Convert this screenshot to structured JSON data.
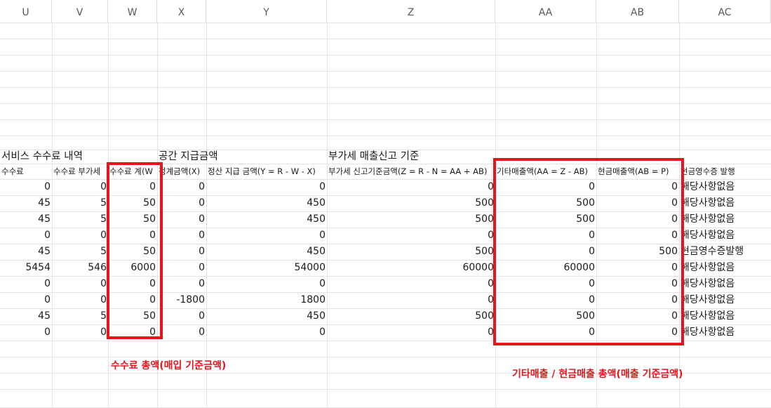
{
  "columns": [
    "U",
    "V",
    "W",
    "X",
    "Y",
    "Z",
    "AA",
    "AB",
    "AC"
  ],
  "sections": {
    "service_fee": "서비스 수수료 내역",
    "space_payment": "공간 지급금액",
    "vat": "부가세 매출신고 기준"
  },
  "headers": [
    "수수료",
    "수수료 부가세",
    "수수료 계(W",
    "정계금액(X)",
    "정산 지급 금액(Y = R - W - X)",
    "부가세 신고기준금액(Z = R - N = AA + AB)",
    "기타매출액(AA = Z - AB)",
    "현금매출액(AB = P)",
    "현금영수증 발행"
  ],
  "rows": [
    [
      "0",
      "0",
      "0",
      "0",
      "0",
      "0",
      "0",
      "0",
      "해당사항없음"
    ],
    [
      "45",
      "5",
      "50",
      "0",
      "450",
      "500",
      "500",
      "0",
      "해당사항없음"
    ],
    [
      "45",
      "5",
      "50",
      "0",
      "450",
      "500",
      "500",
      "0",
      "해당사항없음"
    ],
    [
      "0",
      "0",
      "0",
      "0",
      "0",
      "0",
      "0",
      "0",
      "해당사항없음"
    ],
    [
      "45",
      "5",
      "50",
      "0",
      "450",
      "500",
      "0",
      "500",
      "현금영수증발행"
    ],
    [
      "5454",
      "546",
      "6000",
      "0",
      "54000",
      "60000",
      "60000",
      "0",
      "해당사항없음"
    ],
    [
      "0",
      "0",
      "0",
      "0",
      "0",
      "0",
      "0",
      "0",
      "해당사항없음"
    ],
    [
      "0",
      "0",
      "0",
      "-1800",
      "1800",
      "0",
      "0",
      "0",
      "해당사항없음"
    ],
    [
      "45",
      "5",
      "50",
      "0",
      "450",
      "500",
      "500",
      "0",
      "해당사항없음"
    ],
    [
      "0",
      "0",
      "0",
      "0",
      "0",
      "0",
      "0",
      "0",
      "해당사항없음"
    ]
  ],
  "annotations": {
    "fee_total": "수수료 총액(매입 기준금액)",
    "sales_total": "기타매출 / 현금매출 총액(매출 기준금액)"
  },
  "colors": {
    "highlight": "#e8141c",
    "grid": "#e3e3e3"
  }
}
